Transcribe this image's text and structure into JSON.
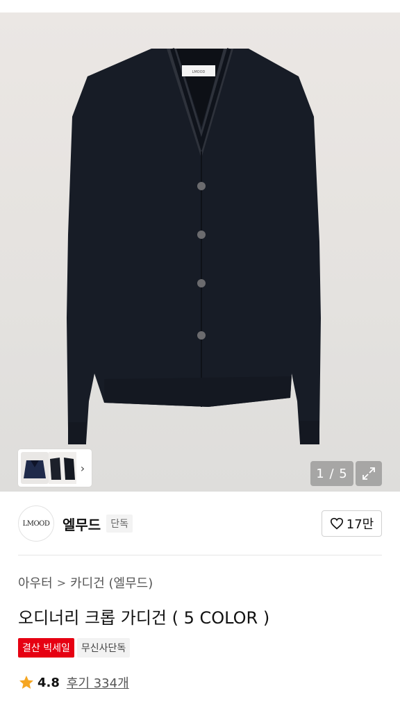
{
  "gallery": {
    "counter_current": "1",
    "counter_total": "5",
    "counter_text": "1 / 5",
    "thumbnail_count": 3,
    "thumb_chevron": "›",
    "expand_icon": "expand-icon"
  },
  "brand": {
    "logo_text": "LMOOD",
    "name": "엘무드",
    "tag": "단독",
    "like_count": "17만"
  },
  "breadcrumb": {
    "items": [
      "아우터",
      "카디건 (엘무드)"
    ],
    "separator": ">"
  },
  "product": {
    "title": "오디너리 크롭 가디건 ( 5 COLOR )",
    "badges": {
      "sale": "결산 빅세일",
      "exclusive": "무신사단독"
    },
    "rating": "4.8",
    "reviews": "후기 334개"
  },
  "colors": {
    "accent_red": "#e60012",
    "star": "#f5a623",
    "garment": "#171c26"
  }
}
